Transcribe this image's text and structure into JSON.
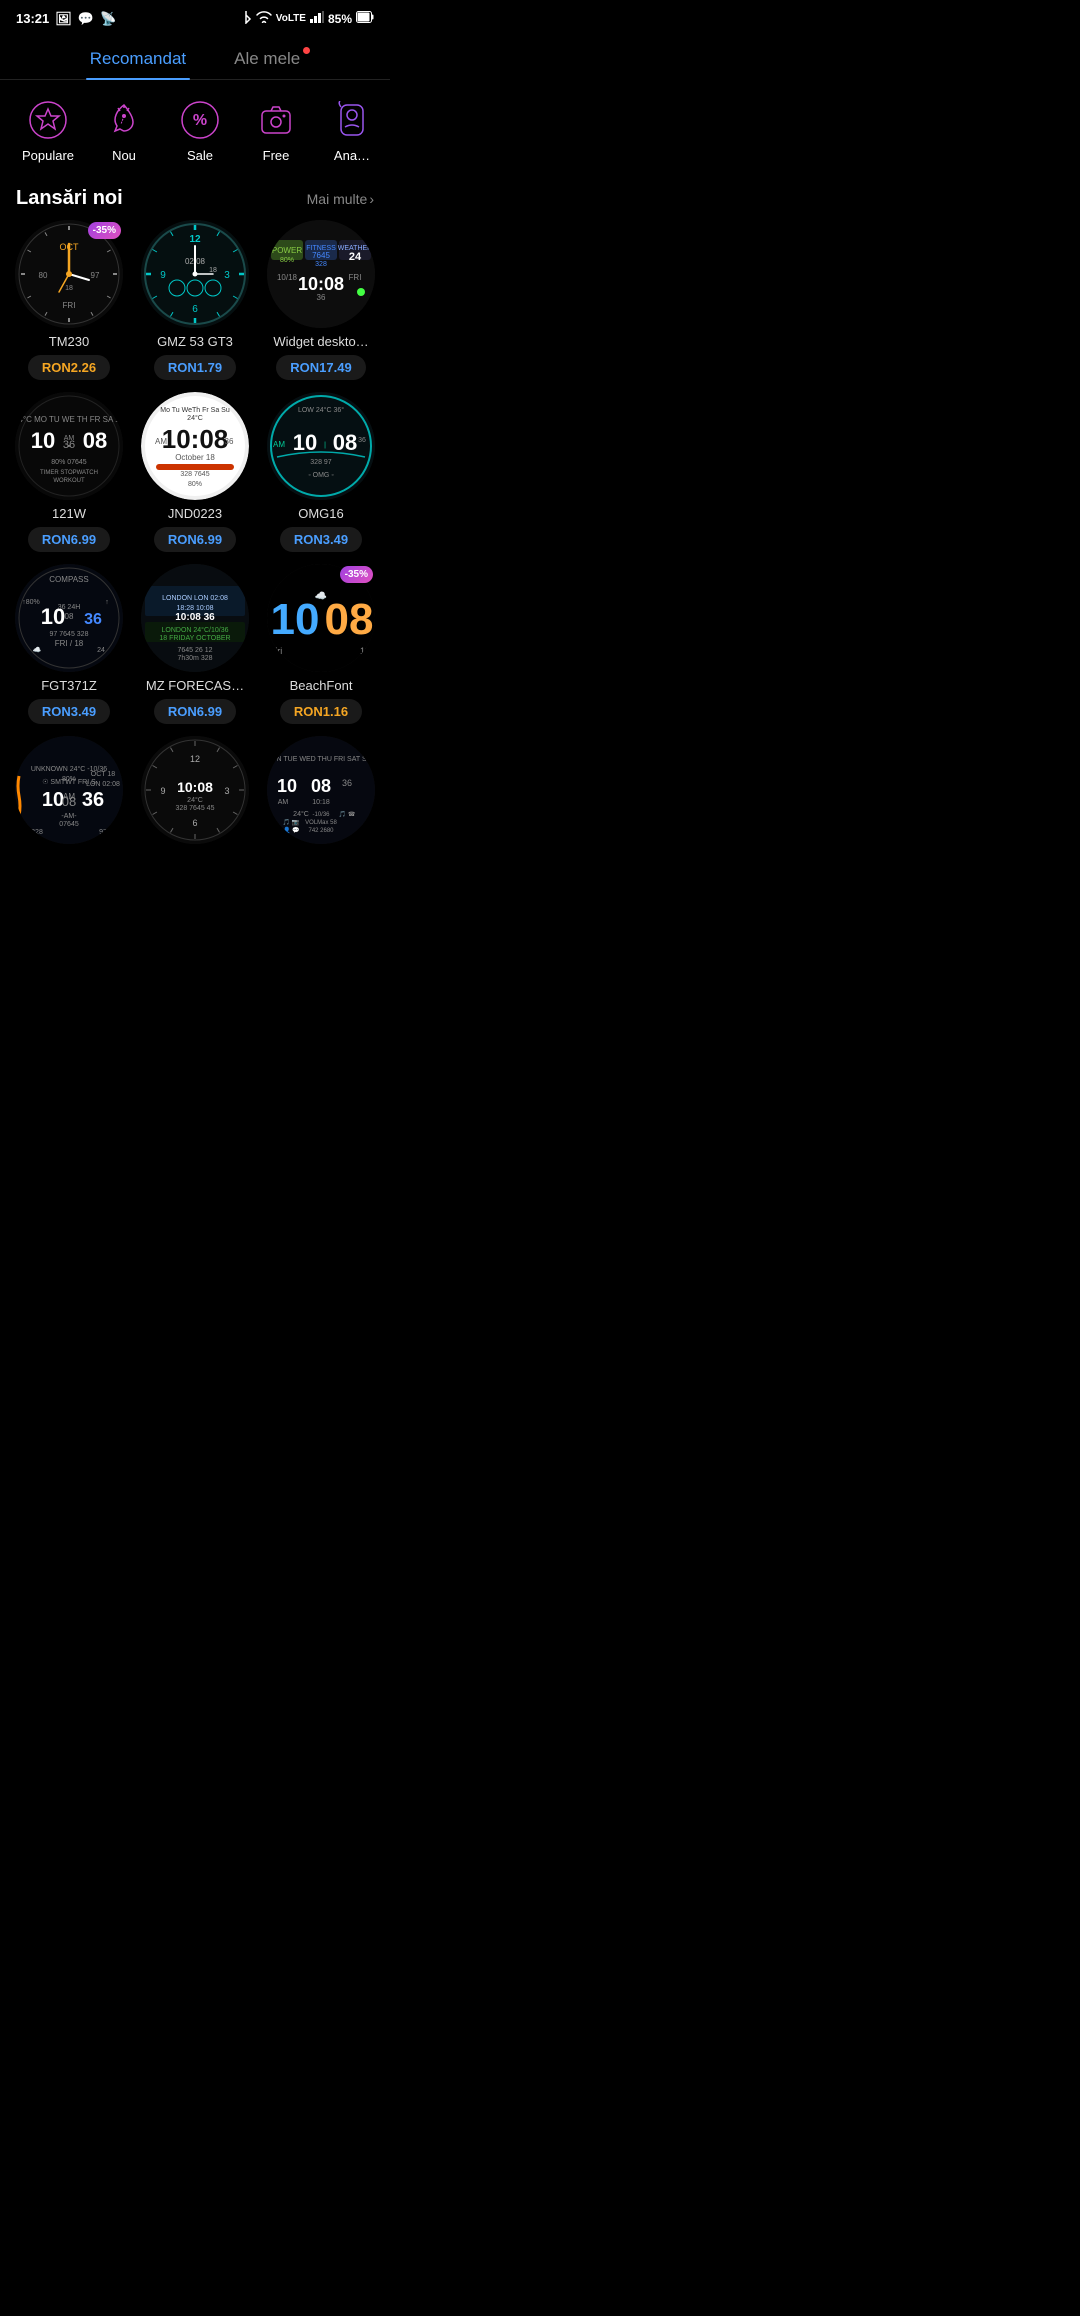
{
  "status": {
    "time": "13:21",
    "battery": "85%",
    "icons_left": [
      "photo",
      "whatsapp",
      "signal"
    ],
    "icons_right": [
      "bluetooth",
      "wifi",
      "lte",
      "signal-bars",
      "battery"
    ]
  },
  "tabs": [
    {
      "id": "recommended",
      "label": "Recomandat",
      "active": true
    },
    {
      "id": "mine",
      "label": "Ale mele",
      "active": false,
      "has_dot": true
    }
  ],
  "categories": [
    {
      "id": "popular",
      "label": "Populare",
      "icon": "⭐"
    },
    {
      "id": "new",
      "label": "Nou",
      "icon": "🔔"
    },
    {
      "id": "sale",
      "label": "Sale",
      "icon": "🏷️"
    },
    {
      "id": "free",
      "label": "Free",
      "icon": "📷"
    },
    {
      "id": "ana",
      "label": "Ana…",
      "icon": "🔮"
    }
  ],
  "section": {
    "title": "Lansări noi",
    "more": "Mai multe"
  },
  "watches": [
    {
      "id": "tm230",
      "name": "TM230",
      "price": "RON2.26",
      "price_color": "orange",
      "discount": "-35%",
      "style": "analog_dark"
    },
    {
      "id": "gmz53gt3",
      "name": "GMZ 53 GT3",
      "price": "RON1.79",
      "price_color": "blue",
      "discount": null,
      "style": "analog_teal"
    },
    {
      "id": "widget_desktop",
      "name": "Widget deskto…",
      "price": "RON17.49",
      "price_color": "blue",
      "discount": null,
      "style": "widget_info"
    },
    {
      "id": "121w",
      "name": "121W",
      "price": "RON6.99",
      "price_color": "blue",
      "discount": null,
      "style": "digital_dark"
    },
    {
      "id": "jnd0223",
      "name": "JND0223",
      "price": "RON6.99",
      "price_color": "blue",
      "discount": null,
      "style": "digital_white"
    },
    {
      "id": "omg16",
      "name": "OMG16",
      "price": "RON3.49",
      "price_color": "blue",
      "discount": null,
      "style": "digital_teal"
    },
    {
      "id": "fgt371z",
      "name": "FGT371Z",
      "price": "RON3.49",
      "price_color": "blue",
      "discount": null,
      "style": "digital_compass"
    },
    {
      "id": "mz_forecast",
      "name": "MZ FORECAS…",
      "price": "RON6.99",
      "price_color": "blue",
      "discount": null,
      "style": "weather_map"
    },
    {
      "id": "beachfont",
      "name": "BeachFont",
      "price": "RON1.16",
      "price_color": "orange",
      "discount": "-35%",
      "style": "beach_colorful"
    },
    {
      "id": "partial1",
      "name": "",
      "price": "",
      "price_color": "blue",
      "discount": null,
      "style": "partial_dark"
    },
    {
      "id": "partial2",
      "name": "",
      "price": "",
      "price_color": "blue",
      "discount": null,
      "style": "partial_analog"
    },
    {
      "id": "partial3",
      "name": "",
      "price": "",
      "price_color": "blue",
      "discount": null,
      "style": "partial_info"
    }
  ]
}
